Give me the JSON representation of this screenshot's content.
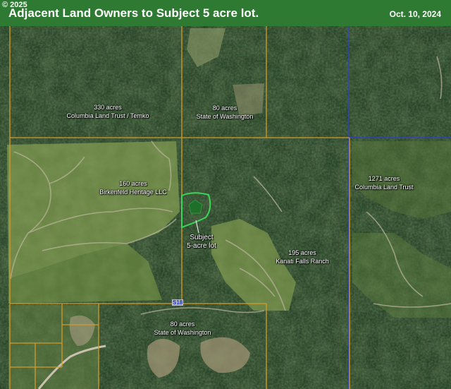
{
  "header": {
    "copyright": "© 2025",
    "title": "Adjacent Land Owners to Subject 5 acre lot.",
    "date": "Oct. 10, 2024"
  },
  "parcels": [
    {
      "acres": "330 acres",
      "owner": "Columbia Land Trust / Temko"
    },
    {
      "acres": "80 acres",
      "owner": "State of Washington"
    },
    {
      "acres": "160 acres",
      "owner": "Birkenfeld Heritage LLC"
    },
    {
      "acres": "1271 acres",
      "owner": "Columbia Land Trust"
    },
    {
      "acres": "195 acres",
      "owner": "Kanati Falls Ranch"
    },
    {
      "acres": "80 acres",
      "owner": "State of Washington"
    }
  ],
  "subject": {
    "line1": "Subject",
    "line2": "5-acre lot"
  },
  "road_label": "S18",
  "colors": {
    "header_bg": "#2e7a32",
    "boundary": "#d69a2a",
    "county_line": "#2d3fd6",
    "subject_outline": "#3cd65a",
    "subject_fill": "#1f6e2a"
  }
}
